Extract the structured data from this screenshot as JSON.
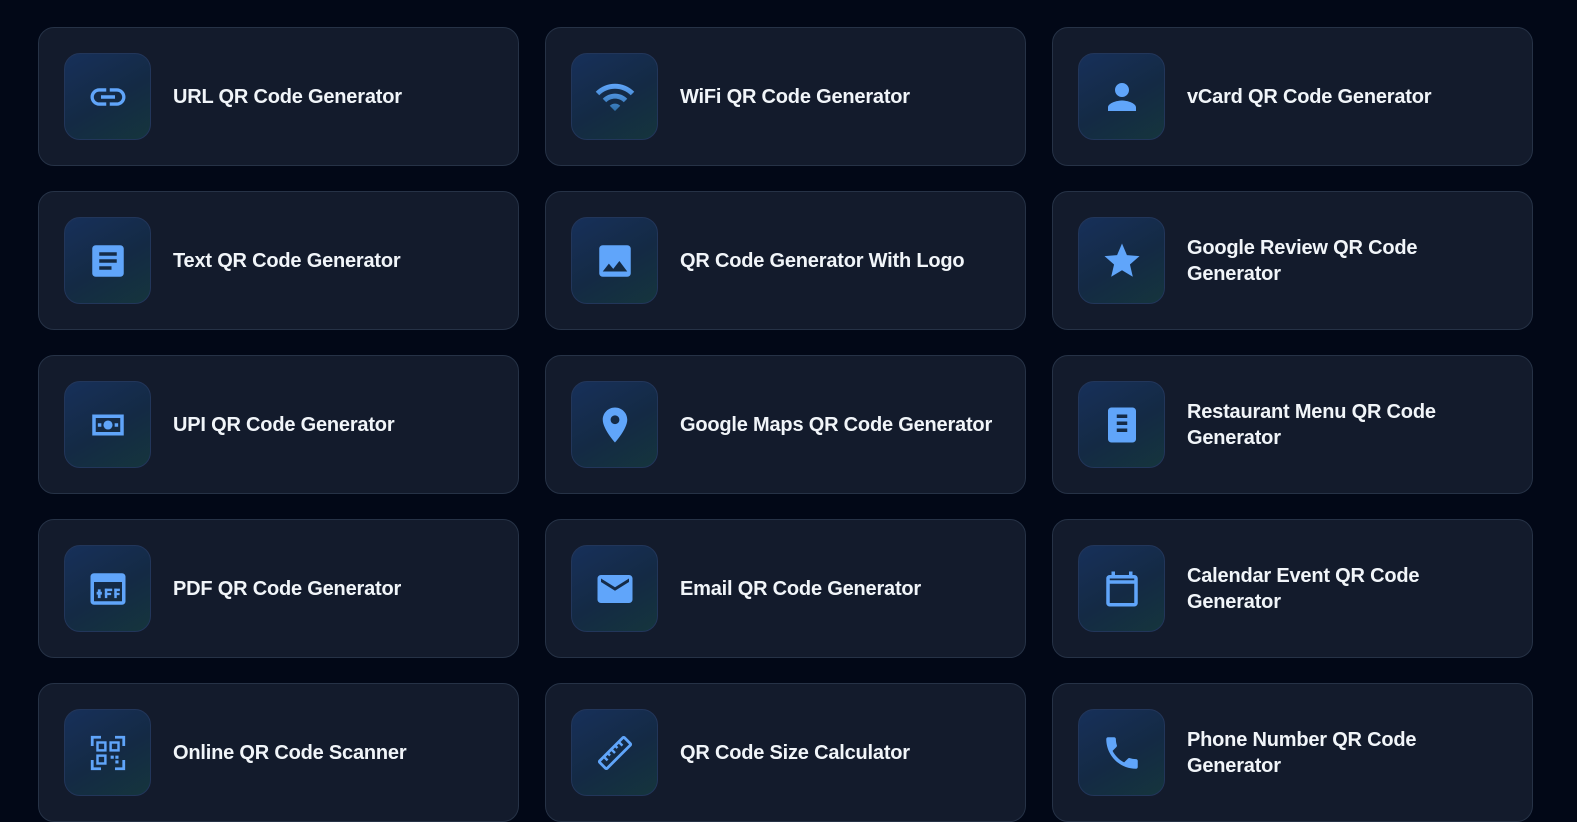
{
  "colors": {
    "background": "#020817",
    "card": "#131b2c",
    "card_border": "#263246",
    "icon_accent": "#60a5fa",
    "text": "#f1f5f9"
  },
  "tools": [
    {
      "label": "URL QR Code Generator",
      "icon": "link-icon"
    },
    {
      "label": "WiFi QR Code Generator",
      "icon": "wifi-icon"
    },
    {
      "label": "vCard QR Code Generator",
      "icon": "person-icon"
    },
    {
      "label": "Text QR Code Generator",
      "icon": "document-icon"
    },
    {
      "label": "QR Code Generator With Logo",
      "icon": "image-icon"
    },
    {
      "label": "Google Review QR Code Generator",
      "icon": "star-icon"
    },
    {
      "label": "UPI QR Code Generator",
      "icon": "money-icon"
    },
    {
      "label": "Google Maps QR Code Generator",
      "icon": "map-pin-icon"
    },
    {
      "label": "Restaurant Menu QR Code Generator",
      "icon": "menu-book-icon"
    },
    {
      "label": "PDF QR Code Generator",
      "icon": "pdf-icon"
    },
    {
      "label": "Email QR Code Generator",
      "icon": "mail-icon"
    },
    {
      "label": "Calendar Event QR Code Generator",
      "icon": "calendar-icon"
    },
    {
      "label": "Online QR Code Scanner",
      "icon": "qr-scan-icon"
    },
    {
      "label": "QR Code Size Calculator",
      "icon": "ruler-icon"
    },
    {
      "label": "Phone Number QR Code Generator",
      "icon": "phone-icon"
    }
  ]
}
